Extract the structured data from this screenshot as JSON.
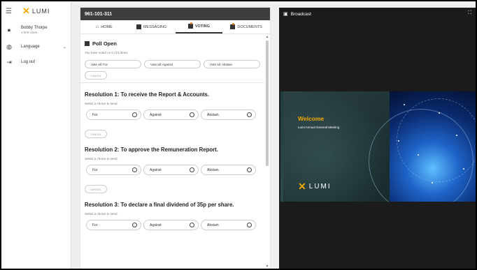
{
  "sidebar": {
    "logo_text": "LUMI",
    "user_name": "Bobby Thorpe",
    "user_votes": "1,000 votes",
    "language_label": "Language",
    "logout_label": "Log out"
  },
  "panel": {
    "meeting_id": "961-101-311",
    "tabs": [
      {
        "label": "HOME"
      },
      {
        "label": "MESSAGING"
      },
      {
        "label": "VOTING"
      },
      {
        "label": "DOCUMENTS"
      }
    ],
    "poll_title": "Poll Open",
    "progress_text": "You have voted on 0 of 5 items",
    "vote_all": [
      "Vote all: For",
      "Vote all: Against",
      "Vote all: Abstain"
    ],
    "cancel_label": "CANCEL",
    "select_hint": "Select a choice to send.",
    "choices": [
      "For",
      "Against",
      "Abstain"
    ],
    "resolutions": [
      "Resolution 1: To receive the Report & Accounts.",
      "Resolution 2: To approve the Remuneration Report.",
      "Resolution 3: To declare a final dividend of 35p per share."
    ]
  },
  "broadcast": {
    "title": "Broadcast",
    "welcome": "Welcome",
    "subtitle": "Lumi Annual General Meeting",
    "logo_text": "LUMI"
  },
  "colors": {
    "accent": "#f2a900",
    "header_bg": "#3d3d3d",
    "broadcast_bg": "#1b1b1b",
    "tab_dot": "#e07a20"
  }
}
